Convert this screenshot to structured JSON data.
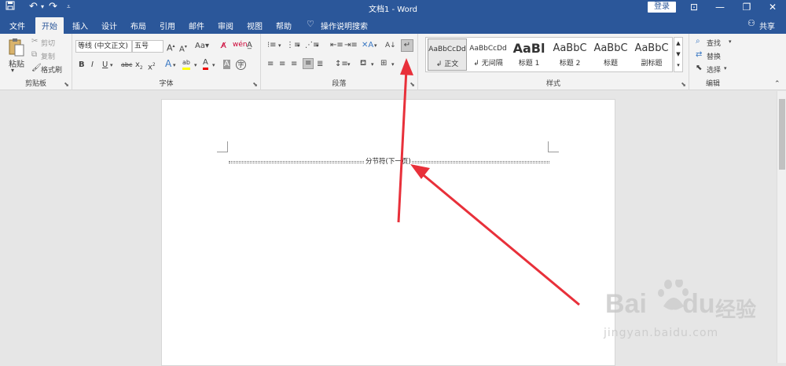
{
  "titlebar": {
    "doc_title": "文档1 - Word",
    "login": "登录"
  },
  "tabs": [
    "文件",
    "开始",
    "插入",
    "设计",
    "布局",
    "引用",
    "邮件",
    "审阅",
    "视图",
    "帮助"
  ],
  "tell_me": "操作说明搜索",
  "share": "共享",
  "clipboard": {
    "paste": "粘贴",
    "cut": "剪切",
    "copy": "复制",
    "painter": "格式刷",
    "label": "剪贴板"
  },
  "font": {
    "name": "等线 (中文正文)",
    "size": "五号",
    "label": "字体"
  },
  "paragraph": {
    "label": "段落"
  },
  "styles": {
    "label": "样式",
    "items": [
      {
        "preview": "AaBbCcDd",
        "name": "正文"
      },
      {
        "preview": "AaBbCcDd",
        "name": "无间隔"
      },
      {
        "preview": "AaBl",
        "name": "标题 1"
      },
      {
        "preview": "AaBbC",
        "name": "标题 2"
      },
      {
        "preview": "AaBbC",
        "name": "标题"
      },
      {
        "preview": "AaBbC",
        "name": "副标题"
      }
    ]
  },
  "editing": {
    "find": "查找",
    "replace": "替换",
    "select": "选择",
    "label": "编辑"
  },
  "document": {
    "section_break": "分节符(下一页)"
  },
  "watermark": {
    "brand": "Bai",
    "brand2": "du",
    "cn": "经验",
    "url": "jingyan.baidu.com"
  },
  "colors": {
    "ribbon_blue": "#2b579a",
    "arrow_red": "#e8303a"
  }
}
